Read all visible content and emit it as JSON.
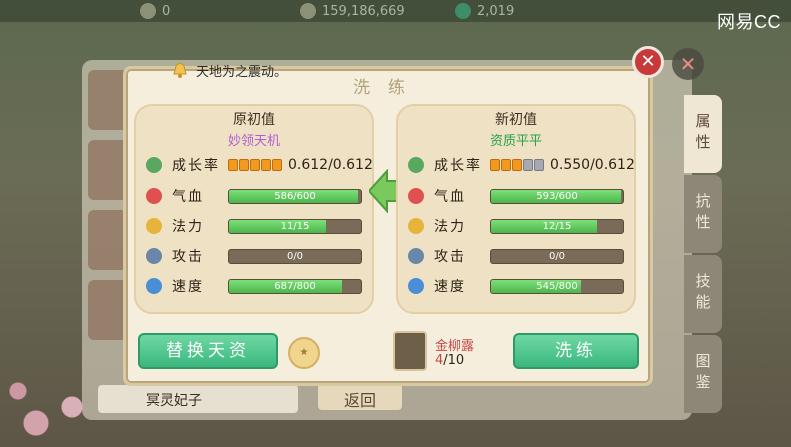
{
  "topbar": {
    "coin_value": "0",
    "money_value": "159,186,669",
    "gem_value": "2,019"
  },
  "watermark": "网易CC",
  "notice_text": "天地为之震动。",
  "dialog": {
    "title": "洗练",
    "close": "✕"
  },
  "background": {
    "close": "✕",
    "list_bottom_name": "冥灵妃子",
    "return_label": "返回",
    "tabs": [
      "属性",
      "抗性",
      "技能",
      "图鉴"
    ]
  },
  "original": {
    "heading": "原初值",
    "subtitle": "妙领天机",
    "growth": {
      "label": "成长率",
      "value": "0.612/0.612",
      "segments": 5,
      "filled": 5
    },
    "stats": [
      {
        "label": "气血",
        "text": "586/600",
        "ratio": 0.977
      },
      {
        "label": "法力",
        "text": "11/15",
        "ratio": 0.733
      },
      {
        "label": "攻击",
        "text": "0/0",
        "ratio": 0
      },
      {
        "label": "速度",
        "text": "687/800",
        "ratio": 0.859
      }
    ]
  },
  "new": {
    "heading": "新初值",
    "subtitle": "资质平平",
    "growth": {
      "label": "成长率",
      "value": "0.550/0.612",
      "segments": 5,
      "filled": 3
    },
    "stats": [
      {
        "label": "气血",
        "text": "593/600",
        "ratio": 0.988
      },
      {
        "label": "法力",
        "text": "12/15",
        "ratio": 0.8
      },
      {
        "label": "攻击",
        "text": "0/0",
        "ratio": 0
      },
      {
        "label": "速度",
        "text": "545/800",
        "ratio": 0.681
      }
    ]
  },
  "actions": {
    "replace_label": "替换天资",
    "wash_label": "洗练",
    "item_name": "金柳露",
    "item_current": "4",
    "item_total": "/10"
  },
  "colors": {
    "accent_green": "#3ab77d",
    "bar_fill": "#4cb54b",
    "growth_orange": "#f29a1e",
    "item_red": "#c64a4a"
  }
}
